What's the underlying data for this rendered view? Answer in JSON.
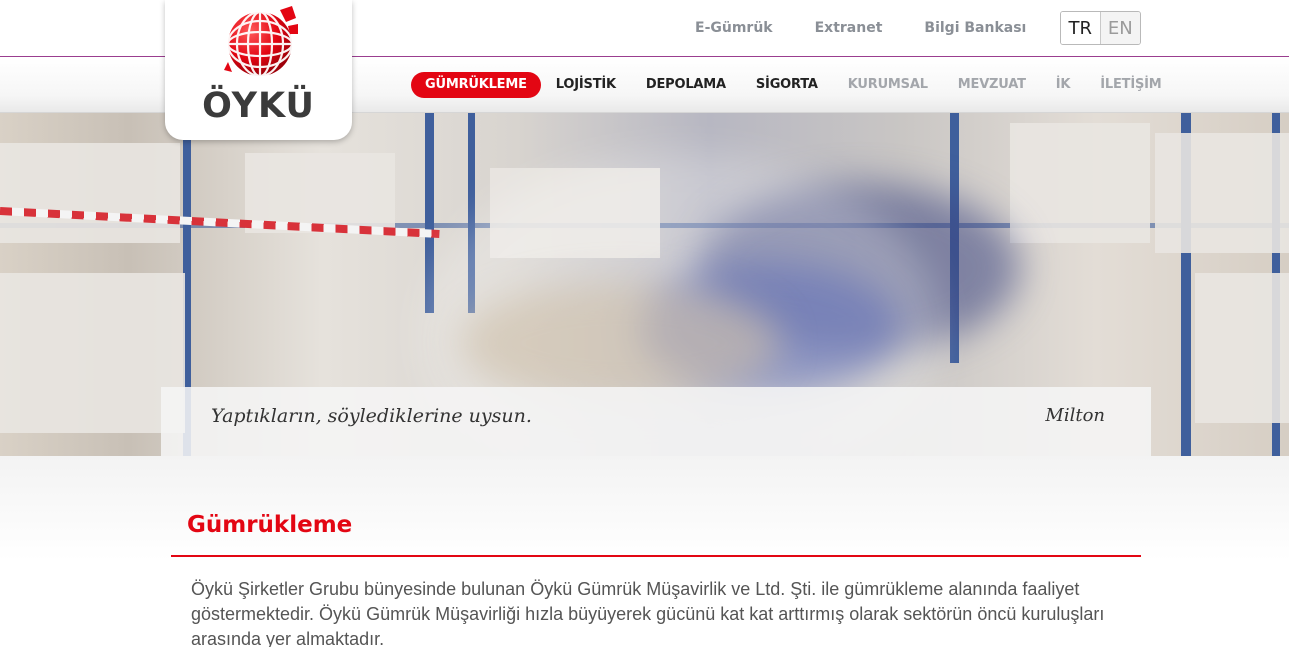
{
  "brand": {
    "name": "ÖYKÜ",
    "accent_color": "#e30613"
  },
  "top_links": [
    "E-Gümrük",
    "Extranet",
    "Bilgi Bankası"
  ],
  "language": {
    "active": "TR",
    "other": "EN"
  },
  "main_nav": [
    {
      "label": "GÜMRÜKLEME",
      "state": "active"
    },
    {
      "label": "LOJİSTİK",
      "state": "normal"
    },
    {
      "label": "DEPOLAMA",
      "state": "normal"
    },
    {
      "label": "SİGORTA",
      "state": "normal"
    },
    {
      "label": "KURUMSAL",
      "state": "muted"
    },
    {
      "label": "MEVZUAT",
      "state": "muted"
    },
    {
      "label": "İK",
      "state": "muted"
    },
    {
      "label": "İLETİŞİM",
      "state": "muted"
    }
  ],
  "hero": {
    "quote": "Yaptıkların, söylediklerine uysun.",
    "author": "Milton"
  },
  "section": {
    "title": "Gümrükleme",
    "body": "Öykü Şirketler Grubu bünyesinde bulunan Öykü Gümrük Müşavirlik ve Ltd. Şti. ile gümrükleme alanında faaliyet göstermektedir. Öykü Gümrük Müşavirliği hızla büyüyerek gücünü kat kat arttırmış olarak sektörün öncü kuruluşları arasında yer almaktadır."
  }
}
